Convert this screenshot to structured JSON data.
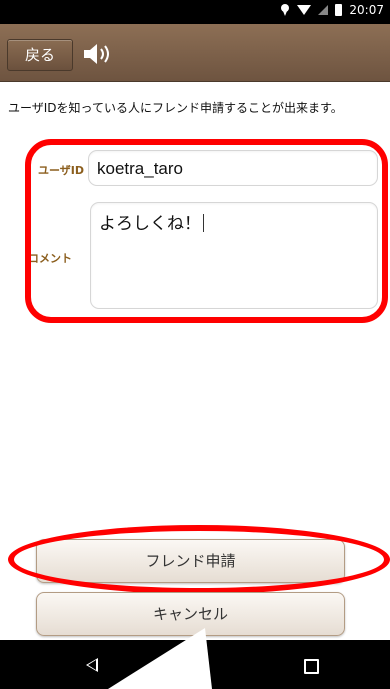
{
  "status_bar": {
    "time": "20:07"
  },
  "title_bar": {
    "back_label": "戻る"
  },
  "form": {
    "intro_text": "ユーザIDを知っている人にフレンド申請することが出来ます。",
    "user_id_label": "ユーザID",
    "user_id_value": "koetra_taro",
    "comment_label": "コメント",
    "comment_value": "よろしくね！"
  },
  "buttons": {
    "request_label": "フレンド申請",
    "cancel_label": "キャンセル"
  },
  "colors": {
    "titlebar": "#7b5f49",
    "label": "#8b5e1d",
    "highlight": "#ff0000"
  }
}
